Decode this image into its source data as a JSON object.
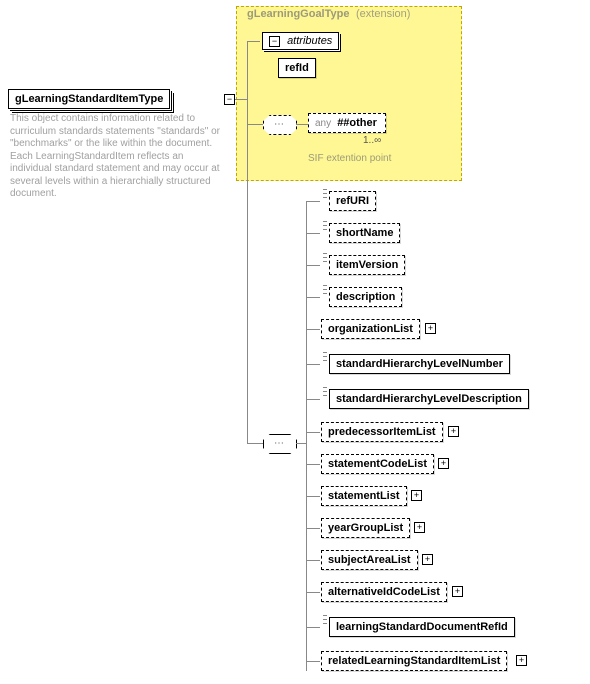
{
  "root": {
    "name": "gLearningStandardItemType",
    "description": "This object contains information related to curriculum standards statements \"standards\" or \"benchmarks\" or the like within the document. Each LearningStandardItem reflects an individual standard statement and may occur at several levels within a hierarchially structured document."
  },
  "extension": {
    "title": "gLearningGoalType",
    "subtitle": "(extension)",
    "attributes_label": "attributes",
    "attributes": {
      "refId": "refId"
    },
    "any_prefix": "any",
    "any_value": "##other",
    "cardinality": "1..∞",
    "note": "SIF extention point"
  },
  "children": [
    {
      "key": "refURI",
      "label": "refURI",
      "optional": true,
      "expandable": false
    },
    {
      "key": "shortName",
      "label": "shortName",
      "optional": true,
      "expandable": false
    },
    {
      "key": "itemVersion",
      "label": "itemVersion",
      "optional": true,
      "expandable": false
    },
    {
      "key": "description",
      "label": "description",
      "optional": true,
      "expandable": false
    },
    {
      "key": "organizationList",
      "label": "organizationList",
      "optional": true,
      "expandable": true
    },
    {
      "key": "standardHierarchyLevelNumber",
      "label": "standardHierarchyLevelNumber",
      "optional": false,
      "expandable": false
    },
    {
      "key": "standardHierarchyLevelDescription",
      "label": "standardHierarchyLevelDescription",
      "optional": false,
      "expandable": false
    },
    {
      "key": "predecessorItemList",
      "label": "predecessorItemList",
      "optional": true,
      "expandable": true
    },
    {
      "key": "statementCodeList",
      "label": "statementCodeList",
      "optional": true,
      "expandable": true
    },
    {
      "key": "statementList",
      "label": "statementList",
      "optional": true,
      "expandable": true
    },
    {
      "key": "yearGroupList",
      "label": "yearGroupList",
      "optional": true,
      "expandable": true
    },
    {
      "key": "subjectAreaList",
      "label": "subjectAreaList",
      "optional": true,
      "expandable": true
    },
    {
      "key": "alternativeIdCodeList",
      "label": "alternativeIdCodeList",
      "optional": true,
      "expandable": true
    },
    {
      "key": "learningStandardDocumentRefId",
      "label": "learningStandardDocumentRefId",
      "optional": false,
      "expandable": false
    },
    {
      "key": "relatedLearningStandardItemList",
      "label": "relatedLearningStandardItemList",
      "optional": true,
      "expandable": true
    }
  ]
}
